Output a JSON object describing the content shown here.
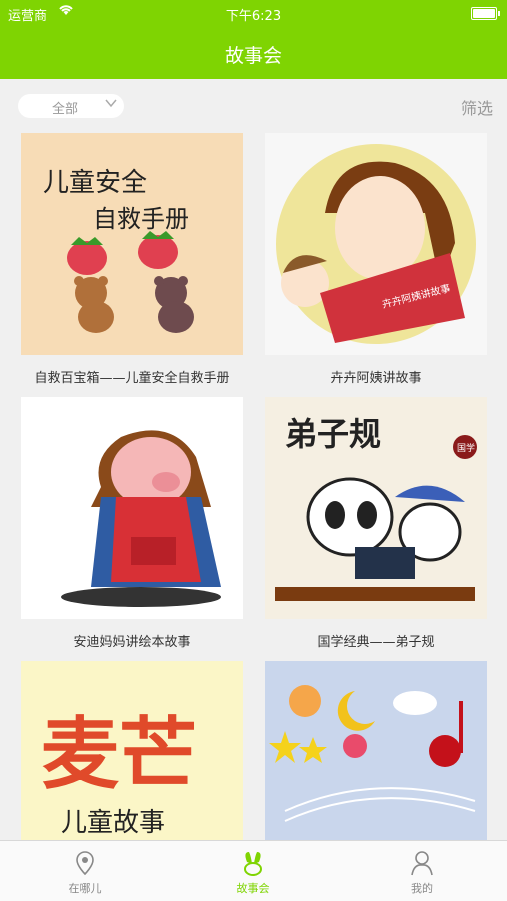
{
  "status_bar": {
    "carrier": "运营商",
    "time": "下午6:23"
  },
  "nav": {
    "title": "故事会"
  },
  "filter": {
    "category": "全部",
    "screen_label": "筛选"
  },
  "stories": [
    {
      "title": "自救百宝箱——儿童安全自救手册",
      "cover_text_line1": "儿童安全",
      "cover_text_line2": "自救手册"
    },
    {
      "title": "卉卉阿姨讲故事",
      "book_text": "卉卉阿姨讲故事"
    },
    {
      "title": "安迪妈妈讲绘本故事"
    },
    {
      "title": "国学经典——弟子规",
      "cover_text": "弟子规",
      "seal_text": "国学"
    },
    {
      "title": "",
      "cover_text": "麦芒",
      "cover_sub": "儿童故事"
    },
    {
      "title": ""
    }
  ],
  "tabs": [
    {
      "label": "在哪儿",
      "icon": "location-pin-icon",
      "active": false
    },
    {
      "label": "故事会",
      "icon": "bunny-ears-icon",
      "active": true
    },
    {
      "label": "我的",
      "icon": "person-icon",
      "active": false
    }
  ],
  "colors": {
    "accent": "#7fd402"
  }
}
